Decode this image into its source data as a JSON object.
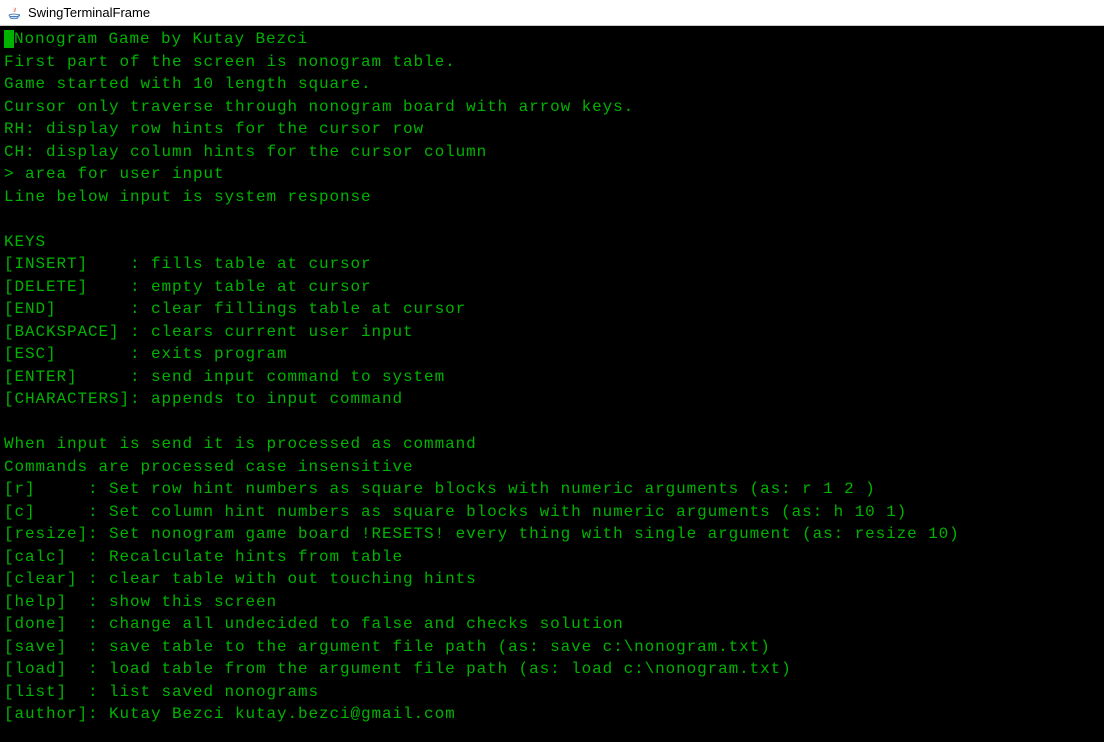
{
  "window": {
    "title": "SwingTerminalFrame"
  },
  "terminal": {
    "lines": [
      {
        "cursor": true,
        "text": "Nonogram Game by Kutay Bezci"
      },
      {
        "cursor": false,
        "text": "First part of the screen is nonogram table."
      },
      {
        "cursor": false,
        "text": "Game started with 10 length square."
      },
      {
        "cursor": false,
        "text": "Cursor only traverse through nonogram board with arrow keys."
      },
      {
        "cursor": false,
        "text": "RH: display row hints for the cursor row"
      },
      {
        "cursor": false,
        "text": "CH: display column hints for the cursor column"
      },
      {
        "cursor": false,
        "text": "> area for user input"
      },
      {
        "cursor": false,
        "text": "Line below input is system response"
      },
      {
        "cursor": false,
        "text": ""
      },
      {
        "cursor": false,
        "text": "KEYS"
      },
      {
        "cursor": false,
        "text": "[INSERT]    : fills table at cursor"
      },
      {
        "cursor": false,
        "text": "[DELETE]    : empty table at cursor"
      },
      {
        "cursor": false,
        "text": "[END]       : clear fillings table at cursor"
      },
      {
        "cursor": false,
        "text": "[BACKSPACE] : clears current user input"
      },
      {
        "cursor": false,
        "text": "[ESC]       : exits program"
      },
      {
        "cursor": false,
        "text": "[ENTER]     : send input command to system"
      },
      {
        "cursor": false,
        "text": "[CHARACTERS]: appends to input command"
      },
      {
        "cursor": false,
        "text": ""
      },
      {
        "cursor": false,
        "text": "When input is send it is processed as command"
      },
      {
        "cursor": false,
        "text": "Commands are processed case insensitive"
      },
      {
        "cursor": false,
        "text": "[r]     : Set row hint numbers as square blocks with numeric arguments (as: r 1 2 )"
      },
      {
        "cursor": false,
        "text": "[c]     : Set column hint numbers as square blocks with numeric arguments (as: h 10 1)"
      },
      {
        "cursor": false,
        "text": "[resize]: Set nonogram game board !RESETS! every thing with single argument (as: resize 10)"
      },
      {
        "cursor": false,
        "text": "[calc]  : Recalculate hints from table"
      },
      {
        "cursor": false,
        "text": "[clear] : clear table with out touching hints"
      },
      {
        "cursor": false,
        "text": "[help]  : show this screen"
      },
      {
        "cursor": false,
        "text": "[done]  : change all undecided to false and checks solution"
      },
      {
        "cursor": false,
        "text": "[save]  : save table to the argument file path (as: save c:\\nonogram.txt)"
      },
      {
        "cursor": false,
        "text": "[load]  : load table from the argument file path (as: load c:\\nonogram.txt)"
      },
      {
        "cursor": false,
        "text": "[list]  : list saved nonograms"
      },
      {
        "cursor": false,
        "text": "[author]: Kutay Bezci kutay.bezci@gmail.com"
      }
    ]
  }
}
